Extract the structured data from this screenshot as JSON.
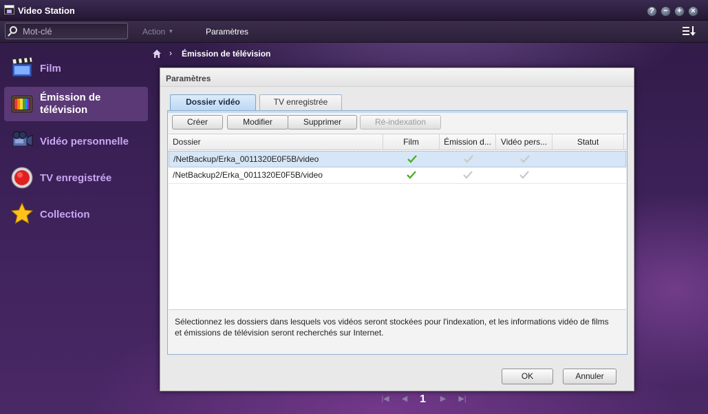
{
  "window": {
    "title": "Video Station"
  },
  "toolbar": {
    "search_placeholder": "Mot-clé",
    "action_label": "Action",
    "settings_label": "Paramètres"
  },
  "sidebar": {
    "items": [
      {
        "label": "Film",
        "icon": "clapperboard-icon",
        "active": false
      },
      {
        "label": "Émission de télévision",
        "line1": "Émission de",
        "line2": "télévision",
        "icon": "tv-icon",
        "active": true
      },
      {
        "label": "Vidéo personnelle",
        "icon": "camcorder-icon",
        "active": false
      },
      {
        "label": "TV enregistrée",
        "icon": "record-icon",
        "active": false
      },
      {
        "label": "Collection",
        "icon": "star-icon",
        "active": false
      }
    ]
  },
  "breadcrumb": {
    "separator": "›",
    "current": "Émission de télévision"
  },
  "pager": {
    "current": "1"
  },
  "dialog": {
    "title": "Paramètres",
    "tabs": [
      {
        "label": "Dossier vidéo",
        "active": true
      },
      {
        "label": "TV enregistrée",
        "active": false
      }
    ],
    "buttons": {
      "create": "Créer",
      "modify": "Modifier",
      "delete": "Supprimer",
      "reindex": "Ré-indexation"
    },
    "columns": [
      "Dossier",
      "Film",
      "Émission d...",
      "Vidéo pers...",
      "Statut"
    ],
    "rows": [
      {
        "folder": "/NetBackup/Erka_0011320E0F5B/video",
        "film": true,
        "tv": false,
        "personal": false,
        "status": "",
        "selected": true
      },
      {
        "folder": "/NetBackup2/Erka_0011320E0F5B/video",
        "film": true,
        "tv": false,
        "personal": false,
        "status": "",
        "selected": false
      }
    ],
    "help_text": "Sélectionnez les dossiers dans lesquels vos vidéos seront stockées pour l'indexation, et les informations vidéo de films et émissions de télévision seront recherchés sur Internet.",
    "ok_label": "OK",
    "cancel_label": "Annuler"
  },
  "colors": {
    "sidebar_text": "#c9a7f2",
    "check_active": "#4caf28",
    "check_inactive": "#c8c8c8",
    "tab_active_bg": "#bcd7f2"
  }
}
